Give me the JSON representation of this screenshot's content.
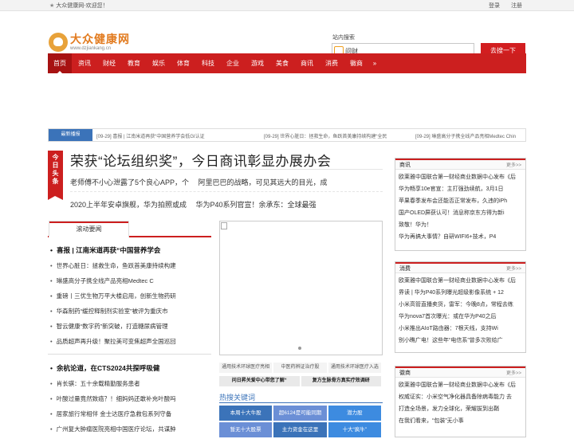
{
  "topbar": {
    "welcome": "大众健康网-欢迎您！",
    "login": "登录",
    "register": "注册"
  },
  "logo": {
    "cn": "大众健康网",
    "en": "www.dzjiankang.cn"
  },
  "search": {
    "label": "站内搜索",
    "value": "问财",
    "button": "去搜一下"
  },
  "nav": {
    "items": [
      "首页",
      "资讯",
      "财经",
      "教育",
      "娱乐",
      "体育",
      "科技",
      "企业",
      "游戏",
      "美食",
      "商讯",
      "消费",
      "徽商"
    ],
    "more": "»"
  },
  "ticker": {
    "tag": "最新播报",
    "items": [
      "[09-29] 喜报 | 江南米道再获“中国营养学会低GI认证",
      "[09-29] 世界心脏日：拯救生命，鱼跃首美康持续构建“全民",
      "[09-29] 琳盛高分子携全线产品亮相Medtec Chin"
    ]
  },
  "headline": {
    "tag": "今日头条",
    "title": "荣获“论坛组织奖”，今日商讯彰显办展办会",
    "sub1": "老师傅不小心泄露了5个良心APP，个 　阿里巴巴的战略，可见其远大的目光，成",
    "sub2": "2020上半年安卓旗舰，华为拍照或成 　华为P40系列官宣！余承东：全球最强"
  },
  "rolling": {
    "tab": "滚动要闻",
    "list1": [
      "喜报 | 江南米道再获“中国营养学会",
      "世界心脏日：拯救生命，鱼跃首美康持续构建",
      "琳盛高分子携全线产品亮相Medtec C",
      "重磅丨三优生物万平大楼启用，创新生物药研",
      "华森制药“缓控释制剂实验室”被评为重庆市",
      "智云健康“数字药”新突破，打造糖尿病管理",
      "品质超声再升级！聚拉美可变焦超声全国巡回"
    ],
    "list2": [
      "余杭论道，在CTS2024共探呼吸健",
      "肖长骐：五十余载精勤服务患者",
      "叶酸过量竟然致癌？！细妈妈还敢补充叶酸吗",
      "居家旅行常相伴 金士达医疗急救包系列守备",
      "广州复大肿瘤医院亮相中国医疗论坛，共谋肿"
    ]
  },
  "links": {
    "row1": [
      "通用技术环球医疗亮相",
      "中医药辨证治疗股",
      "通用技术环球医疗入选"
    ],
    "row2": [
      "问日昇关爱中心带您了解“",
      "复方生脉骨方真实疗效调研"
    ]
  },
  "hot": {
    "title": "热搜关键词",
    "row1": [
      "本周十大牛股",
      "超6124是可能同期",
      "潜力股"
    ],
    "row2": [
      "暂无十大股票",
      "主力资金在这里",
      "十大“疯牛”"
    ]
  },
  "panels": [
    {
      "title": "商讯",
      "more": "更多>>",
      "items": [
        "欧莱雅中国联合第一财经商业数据中心发布《后",
        "华为畅享10e官宣：主打强劲续航，3月1日",
        "苹果春季发布会还能否正常发布，久违的iPh",
        "国产OLED屏获认可！消息称京东方得为新i",
        "致敬！华为！",
        "华为再搞大事情？自研WIFI6+技术，P4"
      ]
    },
    {
      "title": "消费",
      "more": "更多>>",
      "items": [
        "欧莱雅中国联合第一财经商业数据中心发布《后",
        "界读 | 华为P40系列曝光超级影像系统 + 12",
        "小米高管直播卖货，雷军：今晚8点，常程去练",
        "华为nova7首次曝光：或在华为P40之后",
        "小米推出AIoT路由器：7根天线，支持Wi",
        "别小瞧广电！这些年“电信系”曾多次败给广"
      ]
    },
    {
      "title": "徽商",
      "more": "更多>>",
      "items": [
        "欧莱雅中国联合第一财经商业数据中心发布《后",
        "权威证实：小米空气净化器具备除病毒能力 去",
        "打造全场景，发力全球化，荣耀拔到出鞘",
        "在我们看来，“包装”无小事"
      ]
    }
  ]
}
